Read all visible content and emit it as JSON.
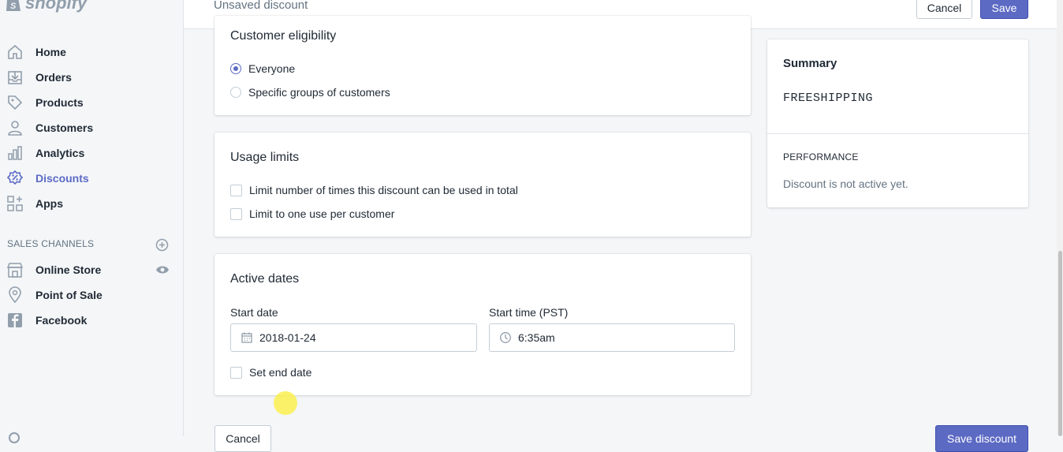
{
  "brand": {
    "name": "shopify"
  },
  "topbar": {
    "title": "Unsaved discount",
    "cancel_label": "Cancel",
    "save_label": "Save"
  },
  "sidebar": {
    "items": [
      {
        "label": "Home",
        "icon": "home-icon"
      },
      {
        "label": "Orders",
        "icon": "orders-icon"
      },
      {
        "label": "Products",
        "icon": "tag-icon"
      },
      {
        "label": "Customers",
        "icon": "person-icon"
      },
      {
        "label": "Analytics",
        "icon": "bar-chart-icon"
      },
      {
        "label": "Discounts",
        "icon": "discount-icon",
        "active": true
      },
      {
        "label": "Apps",
        "icon": "apps-icon"
      }
    ],
    "channels_heading": "SALES CHANNELS",
    "channels": [
      {
        "label": "Online Store",
        "icon": "store-icon"
      },
      {
        "label": "Point of Sale",
        "icon": "location-pin-icon"
      },
      {
        "label": "Facebook",
        "icon": "facebook-icon"
      }
    ]
  },
  "eligibility": {
    "title": "Customer eligibility",
    "options": [
      {
        "label": "Everyone",
        "checked": true
      },
      {
        "label": "Specific groups of customers",
        "checked": false
      }
    ]
  },
  "usage": {
    "title": "Usage limits",
    "options": [
      {
        "label": "Limit number of times this discount can be used in total",
        "checked": false
      },
      {
        "label": "Limit to one use per customer",
        "checked": false
      }
    ]
  },
  "dates": {
    "title": "Active dates",
    "start_date_label": "Start date",
    "start_date_value": "2018-01-24",
    "start_time_label": "Start time (PST)",
    "start_time_value": "6:35am",
    "end_date_label": "Set end date"
  },
  "summary": {
    "heading": "Summary",
    "code": "FREESHIPPING",
    "performance_heading": "PERFORMANCE",
    "performance_text": "Discount is not active yet."
  },
  "footer": {
    "left_button_label": "Cancel",
    "right_button_label": "Save discount"
  },
  "colors": {
    "accent": "#5c6ac4",
    "text": "#212b36",
    "muted": "#637381",
    "border": "#c4cdd5"
  }
}
